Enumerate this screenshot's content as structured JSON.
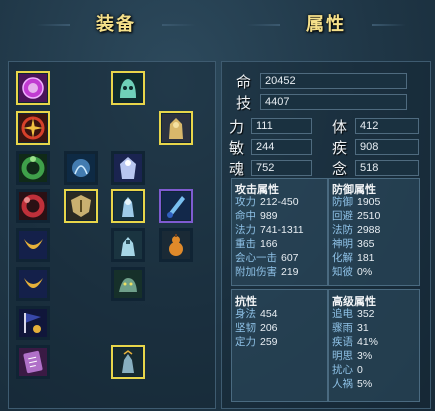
{
  "titles": {
    "equipment": "装备",
    "attributes": "属性"
  },
  "equipment_slots": [
    {
      "name": "purple-rune-amulet",
      "icon": "rune-amulet-icon",
      "color": "#c13bd1"
    },
    {
      "name": "cyan-ghost-helm",
      "icon": "ghost-helm-icon",
      "color": "#6fd1b8"
    },
    {
      "name": "red-compass-charm",
      "icon": "compass-charm-icon",
      "color": "#d6402a"
    },
    {
      "name": "golden-armor",
      "icon": "golden-armor-icon",
      "color": "#d9b86b"
    },
    {
      "name": "green-ring",
      "icon": "green-ring-icon",
      "color": "#3fa04a"
    },
    {
      "name": "blue-spirit-orb",
      "icon": "spirit-orb-icon",
      "color": "#5aa0e0"
    },
    {
      "name": "white-ghost-robe",
      "icon": "ghost-robe-icon",
      "color": "#b8c6f0"
    },
    {
      "name": "red-ring",
      "icon": "red-ring-icon",
      "color": "#c0303a"
    },
    {
      "name": "bone-shield",
      "icon": "bone-shield-icon",
      "color": "#c9b070"
    },
    {
      "name": "spirit-knight",
      "icon": "spirit-knight-icon",
      "color": "#9ecbe8"
    },
    {
      "name": "ice-blade",
      "icon": "ice-blade-icon",
      "color": "#7ac0f0"
    },
    {
      "name": "gold-crescent-1",
      "icon": "crescent-icon",
      "color": "#e6b13a"
    },
    {
      "name": "ice-warrior",
      "icon": "ice-warrior-icon",
      "color": "#a6d6e6"
    },
    {
      "name": "gourd",
      "icon": "gourd-icon",
      "color": "#e08a2a"
    },
    {
      "name": "gold-crescent-2",
      "icon": "crescent-icon",
      "color": "#e6b13a"
    },
    {
      "name": "jade-beast",
      "icon": "jade-beast-icon",
      "color": "#6fa08a"
    },
    {
      "name": "night-flag",
      "icon": "flag-icon",
      "color": "#3848a8"
    },
    {
      "name": "purple-talisman",
      "icon": "talisman-icon",
      "color": "#b070c8"
    },
    {
      "name": "shadow-sage",
      "icon": "shadow-sage-icon",
      "color": "#88b0c0"
    }
  ],
  "top_stats": [
    {
      "label": "命",
      "value": "20452"
    },
    {
      "label": "技",
      "value": "4407"
    }
  ],
  "base_stats_left": [
    {
      "label": "力",
      "value": "111"
    },
    {
      "label": "敏",
      "value": "244"
    },
    {
      "label": "魂",
      "value": "752"
    }
  ],
  "base_stats_right": [
    {
      "label": "体",
      "value": "412"
    },
    {
      "label": "疾",
      "value": "908"
    },
    {
      "label": "念",
      "value": "518"
    }
  ],
  "attack_panel": {
    "title": "攻击属性",
    "rows": [
      {
        "label": "攻力",
        "value": "212-450"
      },
      {
        "label": "命中",
        "value": "989"
      },
      {
        "label": "法力",
        "value": "741-1311"
      },
      {
        "label": "重击",
        "value": "166"
      },
      {
        "label": "会心一击",
        "value": "607"
      },
      {
        "label": "附加伤害",
        "value": "219"
      }
    ]
  },
  "defense_panel": {
    "title": "防御属性",
    "rows": [
      {
        "label": "防御",
        "value": "1905"
      },
      {
        "label": "回避",
        "value": "2510"
      },
      {
        "label": "法防",
        "value": "2988"
      },
      {
        "label": "神明",
        "value": "365"
      },
      {
        "label": "化解",
        "value": "181"
      },
      {
        "label": "知彼",
        "value": "0%"
      }
    ]
  },
  "resist_panel": {
    "title": "抗性",
    "rows": [
      {
        "label": "身法",
        "value": "454"
      },
      {
        "label": "坚韧",
        "value": "206"
      },
      {
        "label": "定力",
        "value": "259"
      }
    ]
  },
  "advanced_panel": {
    "title": "高级属性",
    "rows": [
      {
        "label": "追电",
        "value": "352"
      },
      {
        "label": "骤雨",
        "value": "31"
      },
      {
        "label": "疾语",
        "value": "41%"
      },
      {
        "label": "明思",
        "value": "3%"
      },
      {
        "label": "扰心",
        "value": "0"
      },
      {
        "label": "人祸",
        "value": "5%"
      }
    ]
  }
}
